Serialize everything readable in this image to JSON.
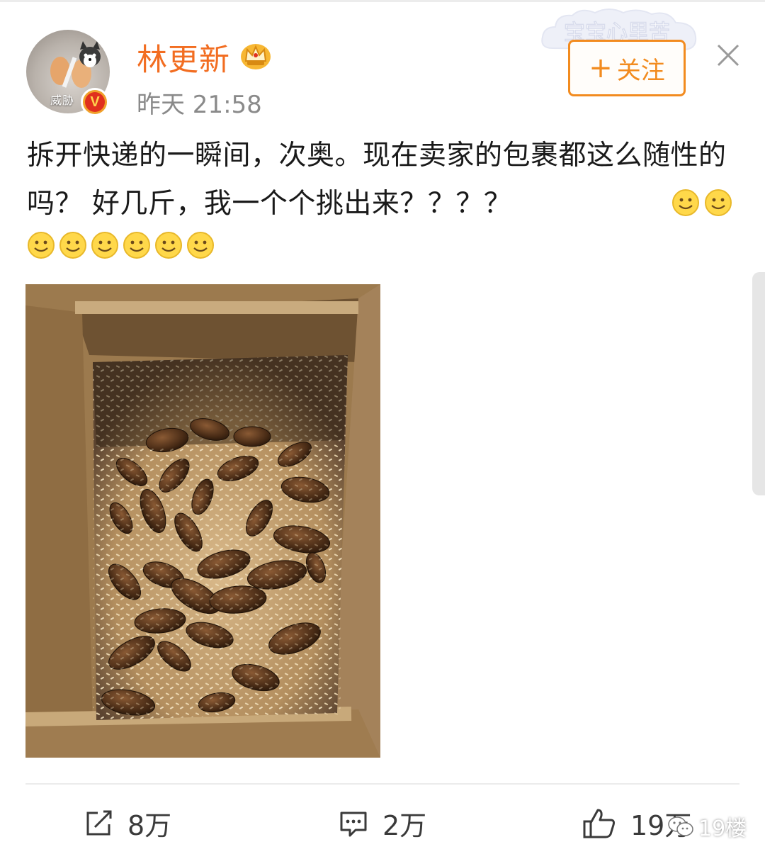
{
  "post": {
    "username": "林更新",
    "timestamp": "昨天 21:58",
    "avatar_tag": "威胁",
    "verified_badge": "V",
    "follow_label": "关注",
    "text": "拆开快递的一瞬间，次奥。现在卖家的包裹都这么随性的吗？ 好几斤，我一个个挑出来？？？？"
  },
  "actions": {
    "repost_count": "8万",
    "comment_count": "2万",
    "like_count": "19万"
  },
  "watermark": {
    "label": "19楼"
  },
  "sticker": {
    "text": "宝宝心里苦"
  },
  "colors": {
    "accent": "#f28b1f",
    "username": "#f26d21",
    "timestamp": "#8a8a8a"
  },
  "icons": [
    "crown-icon",
    "close-icon",
    "repost-icon",
    "comment-icon",
    "like-icon",
    "smile-emoji-icon",
    "wechat-icon"
  ]
}
